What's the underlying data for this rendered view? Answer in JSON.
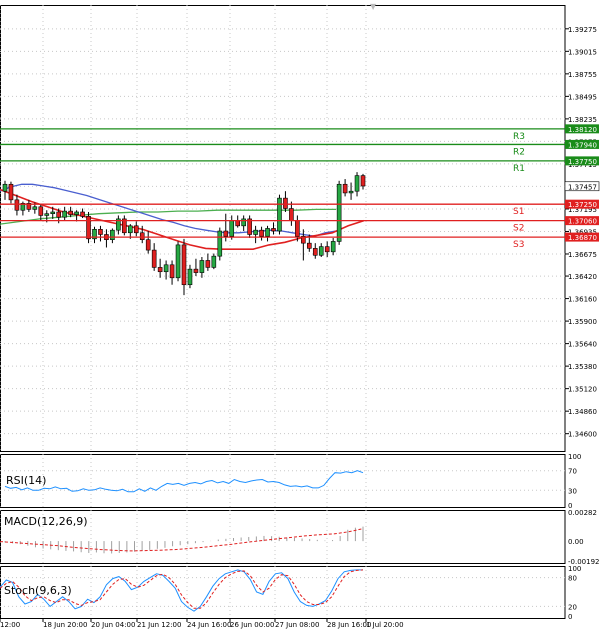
{
  "chart_data": {
    "type": "candlestick",
    "ylim": [
      1.344,
      1.3955
    ],
    "y_ticks": [
      "1.39275",
      "1.39015",
      "1.38755",
      "1.38495",
      "1.38235",
      "1.37975",
      "1.37715",
      "1.37455",
      "1.37195",
      "1.36935",
      "1.36675",
      "1.36420",
      "1.36160",
      "1.35900",
      "1.35640",
      "1.35380",
      "1.35120",
      "1.34860",
      "1.34600"
    ],
    "x_ticks": [
      "12:00",
      "18 Jun 20:00",
      "20 Jun 04:00",
      "21 Jun 12:00",
      "24 Jun 16:00",
      "26 Jun 00:00",
      "27 Jun 08:00",
      "28 Jun 16:00",
      "1 Jul 20:00"
    ],
    "current_price": "1.37457",
    "levels": [
      {
        "name": "R3",
        "value": 1.3812,
        "label": "1.38120",
        "color": "#1a8c1a"
      },
      {
        "name": "R2",
        "value": 1.3794,
        "label": "1.37940",
        "color": "#1a8c1a"
      },
      {
        "name": "R1",
        "value": 1.3775,
        "label": "1.37750",
        "color": "#1a8c1a"
      },
      {
        "name": "S1",
        "value": 1.3725,
        "label": "1.37250",
        "color": "#e02020"
      },
      {
        "name": "S2",
        "value": 1.3706,
        "label": "1.37060",
        "color": "#e02020"
      },
      {
        "name": "S3",
        "value": 1.3687,
        "label": "1.36870",
        "color": "#e02020"
      }
    ],
    "candles": [
      {
        "o": 1.374,
        "h": 1.3752,
        "l": 1.373,
        "c": 1.3748
      },
      {
        "o": 1.3748,
        "h": 1.3751,
        "l": 1.3726,
        "c": 1.373
      },
      {
        "o": 1.373,
        "h": 1.3736,
        "l": 1.3712,
        "c": 1.3718
      },
      {
        "o": 1.3718,
        "h": 1.3728,
        "l": 1.3712,
        "c": 1.3726
      },
      {
        "o": 1.3726,
        "h": 1.373,
        "l": 1.3716,
        "c": 1.3719
      },
      {
        "o": 1.3719,
        "h": 1.3727,
        "l": 1.3714,
        "c": 1.3722
      },
      {
        "o": 1.3722,
        "h": 1.3725,
        "l": 1.3706,
        "c": 1.3712
      },
      {
        "o": 1.3712,
        "h": 1.3718,
        "l": 1.3704,
        "c": 1.3714
      },
      {
        "o": 1.3714,
        "h": 1.3722,
        "l": 1.3708,
        "c": 1.3716
      },
      {
        "o": 1.3716,
        "h": 1.372,
        "l": 1.3703,
        "c": 1.371
      },
      {
        "o": 1.371,
        "h": 1.3722,
        "l": 1.3706,
        "c": 1.3717
      },
      {
        "o": 1.3717,
        "h": 1.3722,
        "l": 1.371,
        "c": 1.3713
      },
      {
        "o": 1.3713,
        "h": 1.3718,
        "l": 1.3705,
        "c": 1.3716
      },
      {
        "o": 1.3716,
        "h": 1.372,
        "l": 1.3709,
        "c": 1.3711
      },
      {
        "o": 1.3711,
        "h": 1.3716,
        "l": 1.368,
        "c": 1.3685
      },
      {
        "o": 1.3685,
        "h": 1.3699,
        "l": 1.368,
        "c": 1.3696
      },
      {
        "o": 1.3696,
        "h": 1.37,
        "l": 1.3682,
        "c": 1.369
      },
      {
        "o": 1.369,
        "h": 1.3696,
        "l": 1.3675,
        "c": 1.3684
      },
      {
        "o": 1.3684,
        "h": 1.3697,
        "l": 1.368,
        "c": 1.3695
      },
      {
        "o": 1.3695,
        "h": 1.3712,
        "l": 1.369,
        "c": 1.3708
      },
      {
        "o": 1.3708,
        "h": 1.3712,
        "l": 1.3689,
        "c": 1.3692
      },
      {
        "o": 1.3692,
        "h": 1.3702,
        "l": 1.3685,
        "c": 1.37
      },
      {
        "o": 1.37,
        "h": 1.3705,
        "l": 1.3688,
        "c": 1.3692
      },
      {
        "o": 1.3692,
        "h": 1.37,
        "l": 1.368,
        "c": 1.3684
      },
      {
        "o": 1.3684,
        "h": 1.3694,
        "l": 1.3668,
        "c": 1.3672
      },
      {
        "o": 1.3672,
        "h": 1.368,
        "l": 1.3648,
        "c": 1.3652
      },
      {
        "o": 1.3652,
        "h": 1.3662,
        "l": 1.364,
        "c": 1.3647
      },
      {
        "o": 1.3647,
        "h": 1.366,
        "l": 1.3638,
        "c": 1.3655
      },
      {
        "o": 1.3655,
        "h": 1.366,
        "l": 1.3632,
        "c": 1.364
      },
      {
        "o": 1.364,
        "h": 1.3682,
        "l": 1.3636,
        "c": 1.3678
      },
      {
        "o": 1.3678,
        "h": 1.3685,
        "l": 1.362,
        "c": 1.3632
      },
      {
        "o": 1.3632,
        "h": 1.3655,
        "l": 1.3628,
        "c": 1.365
      },
      {
        "o": 1.365,
        "h": 1.3662,
        "l": 1.3642,
        "c": 1.3646
      },
      {
        "o": 1.3646,
        "h": 1.3664,
        "l": 1.364,
        "c": 1.366
      },
      {
        "o": 1.366,
        "h": 1.3668,
        "l": 1.3648,
        "c": 1.3652
      },
      {
        "o": 1.3652,
        "h": 1.3668,
        "l": 1.365,
        "c": 1.3665
      },
      {
        "o": 1.3665,
        "h": 1.3698,
        "l": 1.366,
        "c": 1.3694
      },
      {
        "o": 1.3694,
        "h": 1.3714,
        "l": 1.3682,
        "c": 1.3688
      },
      {
        "o": 1.3688,
        "h": 1.3712,
        "l": 1.3684,
        "c": 1.3706
      },
      {
        "o": 1.3706,
        "h": 1.3712,
        "l": 1.3698,
        "c": 1.37
      },
      {
        "o": 1.37,
        "h": 1.3712,
        "l": 1.3694,
        "c": 1.3708
      },
      {
        "o": 1.3708,
        "h": 1.3712,
        "l": 1.3686,
        "c": 1.369
      },
      {
        "o": 1.369,
        "h": 1.37,
        "l": 1.368,
        "c": 1.3695
      },
      {
        "o": 1.3695,
        "h": 1.3699,
        "l": 1.3683,
        "c": 1.3688
      },
      {
        "o": 1.3688,
        "h": 1.37,
        "l": 1.3682,
        "c": 1.3697
      },
      {
        "o": 1.3697,
        "h": 1.3704,
        "l": 1.369,
        "c": 1.3694
      },
      {
        "o": 1.3694,
        "h": 1.3736,
        "l": 1.369,
        "c": 1.3732
      },
      {
        "o": 1.3732,
        "h": 1.374,
        "l": 1.3716,
        "c": 1.372
      },
      {
        "o": 1.372,
        "h": 1.3728,
        "l": 1.37,
        "c": 1.3706
      },
      {
        "o": 1.3706,
        "h": 1.3712,
        "l": 1.3682,
        "c": 1.3688
      },
      {
        "o": 1.3688,
        "h": 1.3696,
        "l": 1.366,
        "c": 1.368
      },
      {
        "o": 1.368,
        "h": 1.369,
        "l": 1.367,
        "c": 1.3674
      },
      {
        "o": 1.3674,
        "h": 1.368,
        "l": 1.3662,
        "c": 1.3666
      },
      {
        "o": 1.3666,
        "h": 1.368,
        "l": 1.3664,
        "c": 1.3676
      },
      {
        "o": 1.3676,
        "h": 1.3682,
        "l": 1.3664,
        "c": 1.367
      },
      {
        "o": 1.367,
        "h": 1.3686,
        "l": 1.3666,
        "c": 1.3682
      },
      {
        "o": 1.3682,
        "h": 1.3752,
        "l": 1.3678,
        "c": 1.3748
      },
      {
        "o": 1.3748,
        "h": 1.3754,
        "l": 1.3734,
        "c": 1.3738
      },
      {
        "o": 1.3738,
        "h": 1.375,
        "l": 1.373,
        "c": 1.374
      },
      {
        "o": 1.374,
        "h": 1.3762,
        "l": 1.3734,
        "c": 1.3758
      },
      {
        "o": 1.3758,
        "h": 1.376,
        "l": 1.3742,
        "c": 1.3746
      }
    ],
    "ma_blue": [
      1.374,
      1.3745,
      1.3748,
      1.3748,
      1.3746,
      1.3744,
      1.3741,
      1.3738,
      1.3735,
      1.3731,
      1.3727,
      1.3723,
      1.3719,
      1.3715,
      1.3711,
      1.3707,
      1.3704,
      1.37,
      1.3697,
      1.3695,
      1.3693,
      1.3692,
      1.3692,
      1.3693,
      1.3694,
      1.3695,
      1.3694,
      1.3692,
      1.369,
      1.3688,
      1.3692,
      1.3694
    ],
    "ma_red": [
      1.3742,
      1.3735,
      1.3728,
      1.3722,
      1.3716,
      1.3712,
      1.3708,
      1.3704,
      1.37,
      1.3696,
      1.369,
      1.3684,
      1.3678,
      1.3674,
      1.3673,
      1.3673,
      1.3673,
      1.3678,
      1.3681,
      1.3686,
      1.3689,
      1.3692,
      1.37,
      1.3706
    ],
    "ma_green": [
      1.3702,
      1.3705,
      1.3708,
      1.371,
      1.3712,
      1.3714,
      1.3715,
      1.3716,
      1.3716,
      1.3717,
      1.3717,
      1.3718,
      1.3718,
      1.3718,
      1.3718,
      1.3718,
      1.3719,
      1.3719
    ],
    "indicators": [
      {
        "name": "RSI(14)",
        "ticks": [
          "100",
          "70",
          "30",
          "0"
        ],
        "range": [
          0,
          100
        ],
        "values": [
          38,
          34,
          36,
          31,
          35,
          30,
          30,
          34,
          33,
          37,
          33,
          34,
          28,
          29,
          33,
          30,
          31,
          35,
          32,
          30,
          29,
          32,
          27,
          27,
          33,
          28,
          35,
          30,
          38,
          44,
          42,
          44,
          40,
          44,
          46,
          43,
          48,
          50,
          45,
          48,
          44,
          52,
          48,
          46,
          49,
          51,
          52,
          47,
          48,
          46,
          41,
          38,
          39,
          37,
          39,
          35,
          35,
          40,
          54,
          66,
          65,
          68,
          66,
          70,
          66
        ]
      },
      {
        "name": "MACD(12,26,9)",
        "ticks": [
          "0.00282",
          "0.00",
          "-0.001929"
        ],
        "range": [
          -0.001929,
          0.00282
        ],
        "signal": [
          -5e-05,
          -0.00015,
          -0.00025,
          -0.00035,
          -0.00045,
          -0.0006,
          -0.00072,
          -0.00082,
          -0.0009,
          -0.00095,
          -0.00092,
          -0.00088,
          -0.00082,
          -0.00072,
          -0.0006,
          -0.00045,
          -0.0003,
          -0.00012,
          5e-05,
          0.0002,
          0.00035,
          0.0005,
          0.00062,
          0.0007,
          0.0009,
          0.0012
        ],
        "histogram": [
          -0.00012,
          -0.00022,
          -0.0003,
          -0.00045,
          -0.0006,
          -0.00072,
          -0.0008,
          -0.00088,
          -0.00095,
          -0.001,
          -0.00108,
          -0.00115,
          -0.0011,
          -0.00118,
          -0.0012,
          -0.00115,
          -0.0011,
          -0.00102,
          -0.00095,
          -0.00085,
          -0.00075,
          -0.00065,
          -0.0005,
          -0.0004,
          -0.0003,
          -0.0002,
          -0.0001,
          2e-05,
          0.00015,
          0.00022,
          0.0003,
          0.00035,
          0.0004,
          0.00045,
          0.0005,
          0.00048,
          0.00042,
          0.00035,
          0.0003,
          0.00025,
          0.0002,
          0.00012,
          5e-05,
          0.0001,
          0.0005,
          0.0011,
          0.0013,
          0.0014
        ]
      },
      {
        "name": "Stoch(9,6,3)",
        "ticks": [
          "100",
          "80",
          "20",
          "0"
        ],
        "range": [
          0,
          100
        ],
        "k": [
          60,
          75,
          70,
          40,
          25,
          30,
          45,
          35,
          20,
          30,
          40,
          30,
          15,
          20,
          35,
          28,
          40,
          65,
          78,
          82,
          72,
          55,
          60,
          72,
          80,
          88,
          85,
          72,
          58,
          30,
          18,
          10,
          20,
          40,
          62,
          78,
          88,
          92,
          96,
          92,
          76,
          50,
          45,
          72,
          88,
          90,
          78,
          50,
          30,
          22,
          20,
          25,
          32,
          52,
          78,
          92,
          95,
          96,
          96
        ],
        "d": [
          58,
          68,
          72,
          60,
          42,
          32,
          38,
          40,
          32,
          28,
          34,
          34,
          26,
          22,
          28,
          30,
          34,
          50,
          66,
          76,
          78,
          66,
          60,
          64,
          74,
          84,
          87,
          80,
          66,
          44,
          28,
          16,
          16,
          28,
          48,
          66,
          80,
          88,
          93,
          94,
          84,
          64,
          50,
          58,
          76,
          86,
          84,
          66,
          44,
          30,
          24,
          24,
          28,
          40,
          62,
          82,
          92,
          95,
          96
        ]
      }
    ]
  },
  "price_axis": {
    "tag_color": "#1a8c1a"
  }
}
